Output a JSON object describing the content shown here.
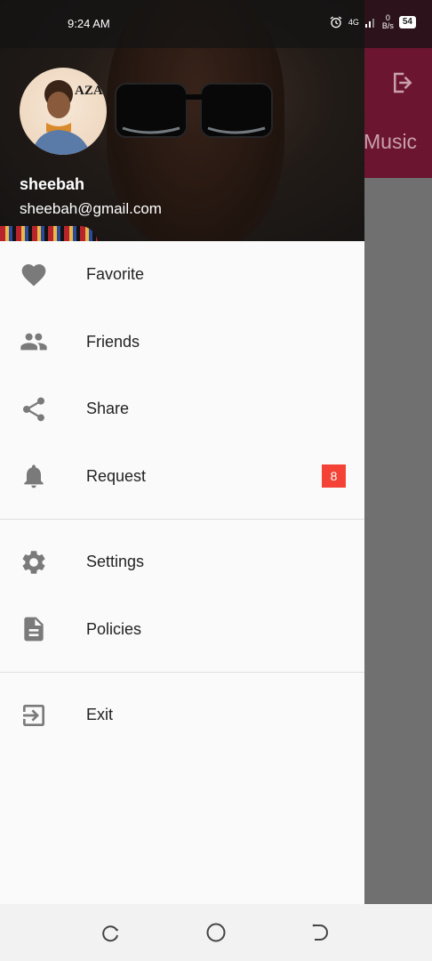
{
  "status_bar": {
    "time": "9:24 AM",
    "network": "4G",
    "speed_value": "0",
    "speed_unit": "B/s",
    "battery": "54"
  },
  "background_app": {
    "title": "Music",
    "logout_icon": "logout-icon",
    "appbar_color": "#6b1530"
  },
  "drawer": {
    "avatar_caption": "AZA",
    "user": {
      "name": "sheebah",
      "email": "sheebah@gmail.com"
    },
    "menu_primary": [
      {
        "label": "Favorite",
        "icon": "heart-icon"
      },
      {
        "label": "Friends",
        "icon": "people-icon"
      },
      {
        "label": "Share",
        "icon": "share-icon"
      },
      {
        "label": "Request",
        "icon": "bell-icon",
        "badge": "8"
      }
    ],
    "menu_secondary": [
      {
        "label": "Settings",
        "icon": "gear-icon"
      },
      {
        "label": "Policies",
        "icon": "document-icon"
      }
    ],
    "menu_tertiary": [
      {
        "label": "Exit",
        "icon": "exit-icon"
      }
    ],
    "icon_color": "#7a7a7a",
    "badge_color": "#f44336"
  },
  "nav_bar": {
    "recent": "recent-apps-icon",
    "home": "home-icon",
    "back": "back-icon"
  }
}
